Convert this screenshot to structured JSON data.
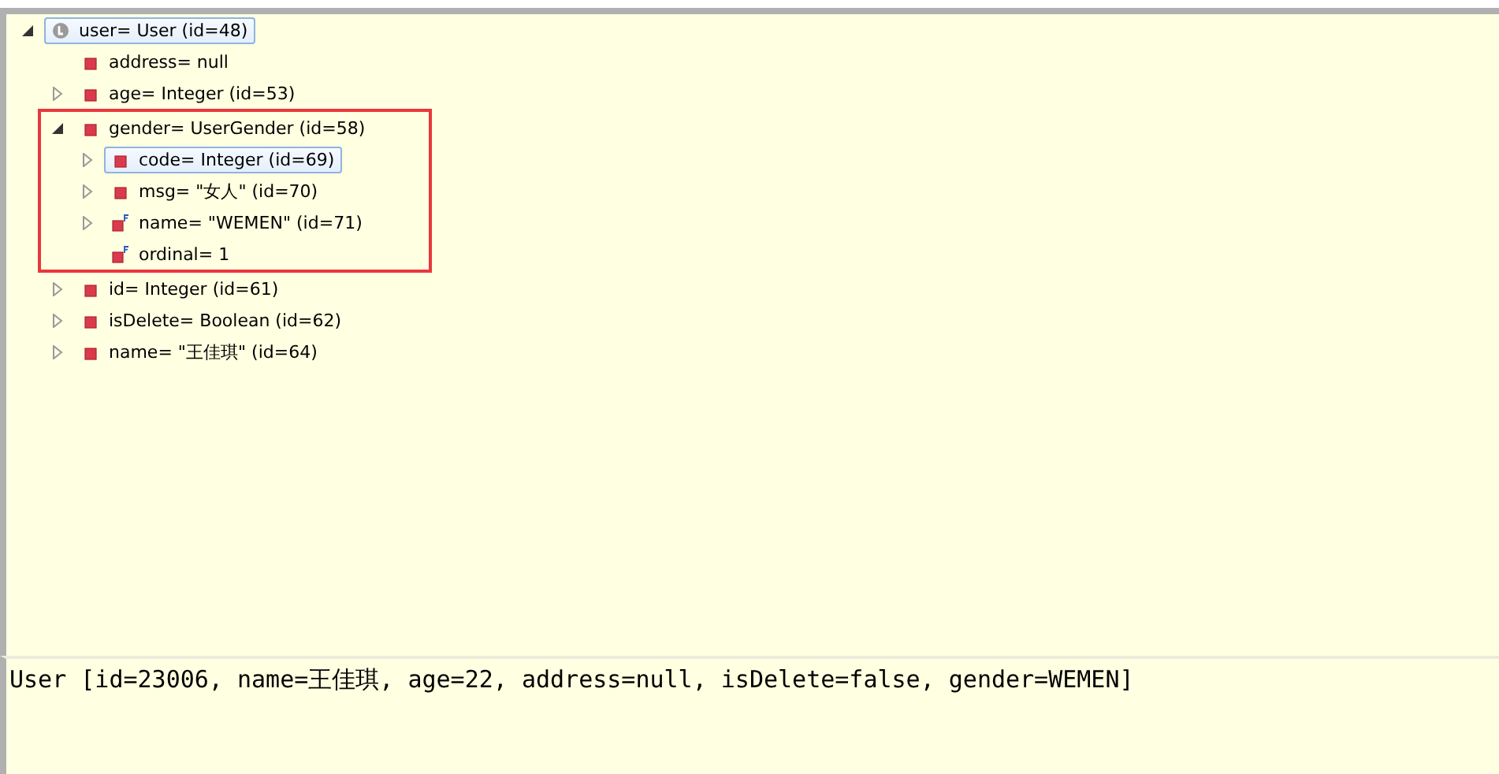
{
  "variables_tree": [
    {
      "label": "user= User  (id=48)",
      "kind": "local",
      "expandable": true,
      "expanded": true,
      "selected": true,
      "highlighted": false,
      "children": [
        {
          "label": "address= null",
          "kind": "field",
          "expandable": false,
          "selected": false,
          "highlighted": false
        },
        {
          "label": "age= Integer  (id=53)",
          "kind": "field",
          "expandable": true,
          "expanded": false,
          "selected": false,
          "highlighted": false
        },
        {
          "label": "gender= UserGender  (id=58)",
          "kind": "field",
          "expandable": true,
          "expanded": true,
          "selected": false,
          "highlighted": true,
          "children": [
            {
              "label": "code= Integer  (id=69)",
              "kind": "field",
              "expandable": true,
              "expanded": false,
              "selected": true,
              "highlighted": false
            },
            {
              "label": "msg= \"女人\" (id=70)",
              "kind": "field",
              "expandable": true,
              "expanded": false,
              "selected": false,
              "highlighted": false
            },
            {
              "label": "name= \"WEMEN\" (id=71)",
              "kind": "final-field",
              "expandable": true,
              "expanded": false,
              "selected": false,
              "highlighted": false
            },
            {
              "label": "ordinal= 1",
              "kind": "final-field",
              "expandable": false,
              "selected": false,
              "highlighted": false
            }
          ]
        },
        {
          "label": "id= Integer  (id=61)",
          "kind": "field",
          "expandable": true,
          "expanded": false,
          "selected": false,
          "highlighted": false
        },
        {
          "label": "isDelete= Boolean  (id=62)",
          "kind": "field",
          "expandable": true,
          "expanded": false,
          "selected": false,
          "highlighted": false
        },
        {
          "label": "name= \"王佳琪\" (id=64)",
          "kind": "field",
          "expandable": true,
          "expanded": false,
          "selected": false,
          "highlighted": false
        }
      ]
    }
  ],
  "detail_pane": {
    "value": "User [id=23006, name=王佳琪, age=22, address=null, isDelete=false, gender=WEMEN]"
  }
}
